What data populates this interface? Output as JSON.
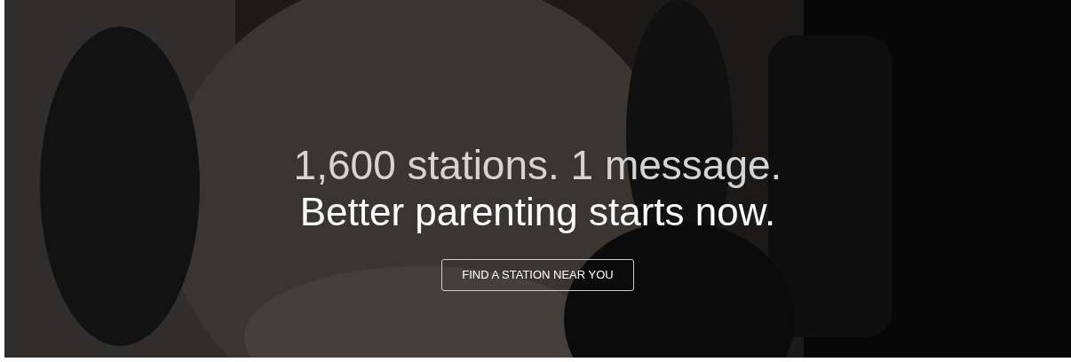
{
  "hero": {
    "headline": "1,600 stations. 1 message.",
    "subheadline": "Better parenting starts now.",
    "button": "FIND A STATION NEAR YOU"
  }
}
